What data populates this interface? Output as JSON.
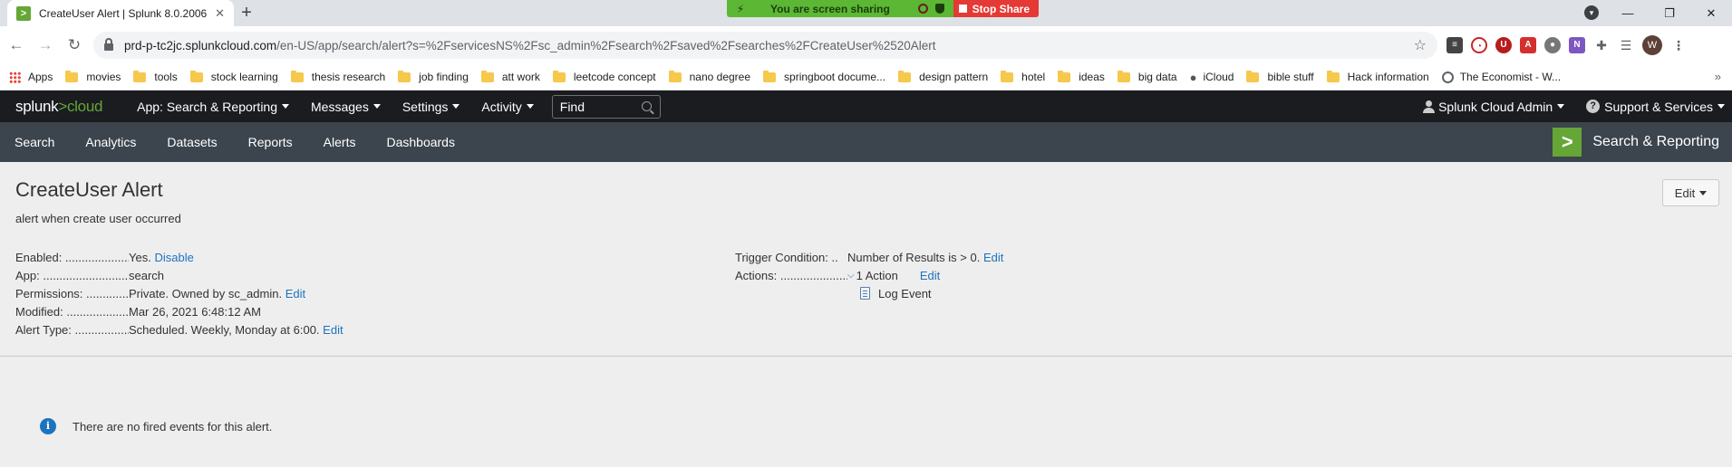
{
  "browser": {
    "tab_title": "CreateUser Alert | Splunk 8.0.2006",
    "url_host": "prd-p-tc2jc.splunkcloud.com",
    "url_path": "/en-US/app/search/alert?s=%2FservicesNS%2Fsc_admin%2Fsearch%2Fsaved%2Fsearches%2FCreateUser%2520Alert",
    "profile_initial": "W"
  },
  "screen_share": {
    "message": "You are screen sharing",
    "stop_label": "Stop Share"
  },
  "bookmarks": [
    {
      "label": "Apps",
      "icon": "apps-grid-icon"
    },
    {
      "label": "movies",
      "icon": "folder-icon"
    },
    {
      "label": "tools",
      "icon": "folder-icon"
    },
    {
      "label": "stock learning",
      "icon": "folder-icon"
    },
    {
      "label": "thesis research",
      "icon": "folder-icon"
    },
    {
      "label": "job finding",
      "icon": "folder-icon"
    },
    {
      "label": "att work",
      "icon": "folder-icon"
    },
    {
      "label": "leetcode concept",
      "icon": "folder-icon"
    },
    {
      "label": "nano degree",
      "icon": "folder-icon"
    },
    {
      "label": "springboot docume...",
      "icon": "folder-icon"
    },
    {
      "label": "design pattern",
      "icon": "folder-icon"
    },
    {
      "label": "hotel",
      "icon": "folder-icon"
    },
    {
      "label": "ideas",
      "icon": "folder-icon"
    },
    {
      "label": "big data",
      "icon": "folder-icon"
    },
    {
      "label": "iCloud",
      "icon": "apple-icon"
    },
    {
      "label": "bible stuff",
      "icon": "folder-icon"
    },
    {
      "label": "Hack information",
      "icon": "folder-icon"
    },
    {
      "label": "The Economist - W...",
      "icon": "globe-icon"
    }
  ],
  "splunk_header": {
    "logo_main": "splunk",
    "logo_arrow": ">",
    "logo_cloud": "cloud",
    "menus": [
      "App: Search & Reporting",
      "Messages",
      "Settings",
      "Activity"
    ],
    "find_placeholder": "Find",
    "user_menu": "Splunk Cloud Admin",
    "support_menu": "Support & Services"
  },
  "app_bar": {
    "nav": [
      "Search",
      "Analytics",
      "Datasets",
      "Reports",
      "Alerts",
      "Dashboards"
    ],
    "app_name": "Search & Reporting"
  },
  "alert": {
    "title": "CreateUser Alert",
    "description": "alert when create user occurred",
    "edit_label": "Edit",
    "enabled_label": "Enabled: ......................",
    "enabled_value": "Yes.",
    "enabled_link": "Disable",
    "app_label": "App: ...............................",
    "app_value": "search",
    "permissions_label": "Permissions: .............",
    "permissions_value": "Private. Owned by sc_admin.",
    "permissions_link": "Edit",
    "modified_label": "Modified: .....................",
    "modified_value": "Mar 26, 2021 6:48:12 AM",
    "alert_type_label": "Alert Type: .................",
    "alert_type_value": "Scheduled. Weekly, Monday at 6:00.",
    "alert_type_link": "Edit",
    "trigger_label": "Trigger Condition: ..",
    "trigger_value": "Number of Results is > 0.",
    "trigger_link": "Edit",
    "actions_label": "Actions: .......................",
    "actions_value": "1 Action",
    "actions_link": "Edit",
    "action_item": "Log Event"
  },
  "notice": {
    "message": "There are no fired events for this alert."
  }
}
